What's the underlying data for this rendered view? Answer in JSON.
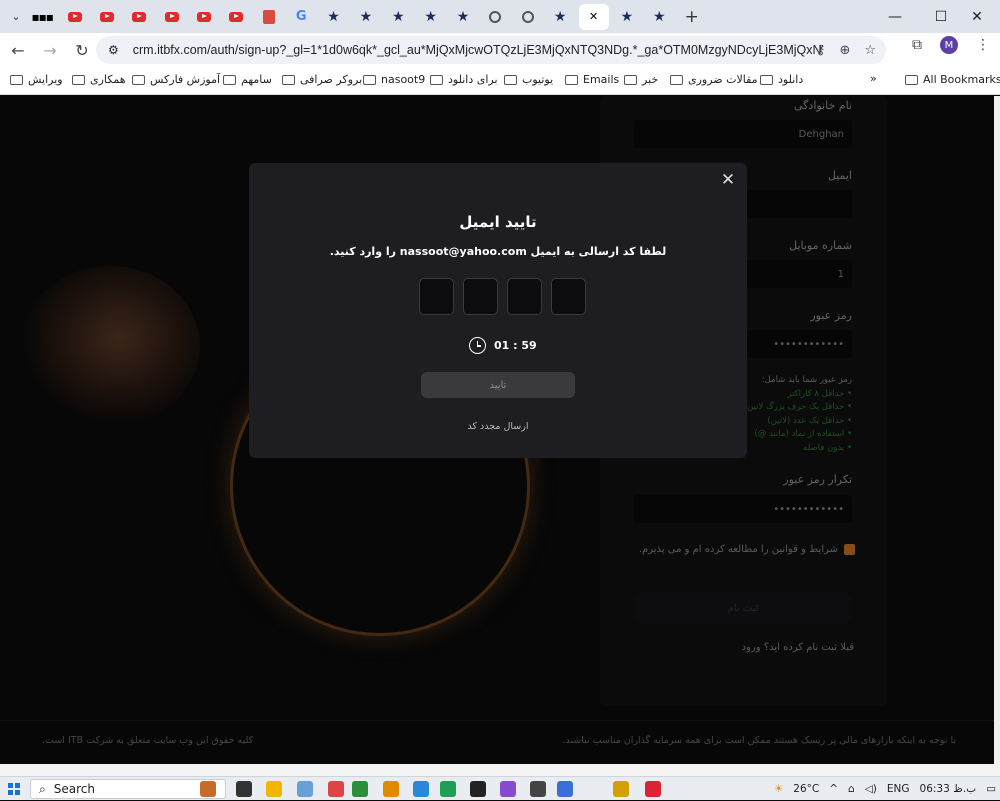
{
  "browser": {
    "url": "crm.itbfx.com/auth/sign-up?_gl=1*1d0w6qk*_gcl_au*MjQxMjcwOTQzLjE3MjQxNTQ3NDg.*_ga*OTM0MzgyNDcyLjE3MjQxNTQ3NTE.*_ga_M...",
    "tabs": [
      "dots-icon",
      "youtube-icon",
      "youtube-icon",
      "youtube-icon",
      "youtube-icon",
      "youtube-icon",
      "youtube-icon",
      "pdf-icon",
      "google-icon",
      "star-icon",
      "star-icon",
      "star-icon",
      "star-icon",
      "star-icon",
      "globe-icon",
      "globe-icon",
      "star-icon",
      "active",
      "star-icon",
      "star-icon"
    ],
    "bookmarks": [
      "ویرایش",
      "همکاری",
      "آموزش فارکس",
      "سامهم",
      "بروکر صرافی",
      "nasoot9",
      "برای دانلود",
      "یوتیوب",
      "Emails",
      "خبر",
      "مقالات ضروری",
      "دانلود"
    ],
    "bookmarks_more": "»",
    "all_bookmarks": "All Bookmarks",
    "avatar_letter": "M"
  },
  "signup": {
    "last_name_label": "نام خانوادگی",
    "last_name_value": "Dehghan",
    "email_label": "ایمیل",
    "mobile_label": "شماره موبایل",
    "mobile_value": "1",
    "password_label": "رمز عبور",
    "password_value": "••••••••••••",
    "rules_head": "رمز عبور شما باید شامل:",
    "rules": [
      "حداقل ۸ کاراکتر",
      "حداقل یک حرف بزرگ لاتین",
      "حداقل یک عدد (لاتین)",
      "استفاده از نماد (مانند @)",
      "بدون فاصله"
    ],
    "confirm_label": "تکرار رمز عبور",
    "confirm_value": "••••••••••••",
    "terms_text": "شرایط و قوانین را مطالعه کرده ام و می پذیرم.",
    "submit_label": "ثبت نام",
    "login_prompt": "قبلا ثبت نام کرده اید؟",
    "login_link": "ورود"
  },
  "footer": {
    "risk": "با توجه به اینکه بازارهای مالی پر ریسک هستند ممکن است برای همه سرمایه گذاران مناسب نباشند.",
    "rights": "کلیه حقوق این وب سایت متعلق به شرکت ITB است."
  },
  "modal": {
    "title": "تایید ایمیل",
    "desc": "لطفا کد ارسالی به ایمیل nassoot@yahoo.com را وارد کنید.",
    "otp_count": 4,
    "timer": "01 : 59",
    "confirm_label": "تایید",
    "resend_label": "ارسال مجدد کد"
  },
  "taskbar": {
    "search_label": "Search",
    "weather": "26°C",
    "lang": "ENG",
    "time": "06:33 ب.ظ"
  },
  "colors": {
    "accent_green": "#2e7a3a",
    "checkbox": "#c87a2a",
    "modal_bg": "#1e1e22"
  }
}
